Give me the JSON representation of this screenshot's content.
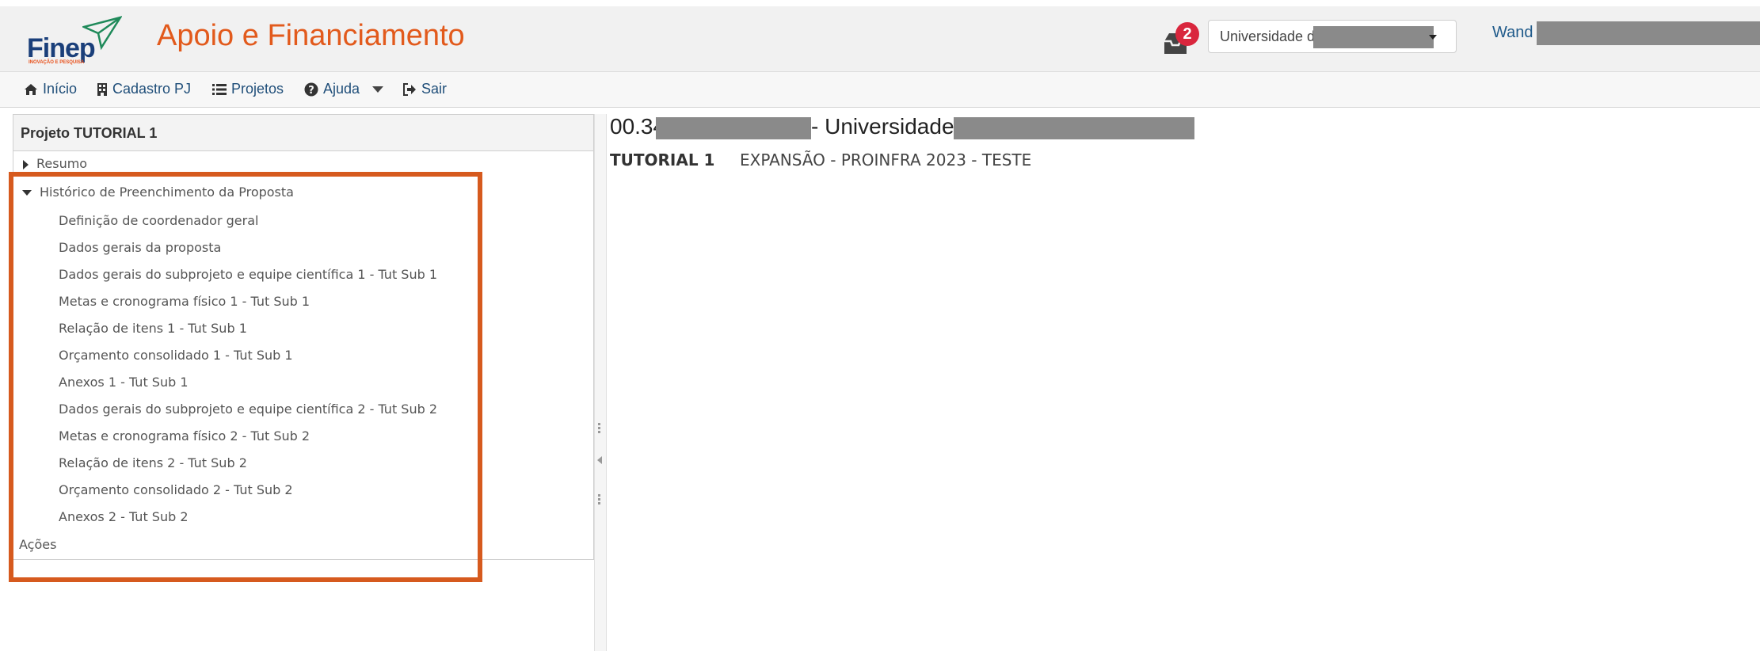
{
  "header": {
    "logo_text": "Finep",
    "logo_tagline": "INOVAÇÃO E PESQUISA",
    "app_title": "Apoio e Financiamento",
    "notification_count": "2",
    "org_select_value": "Universidade d",
    "user_name": "Wand"
  },
  "nav": {
    "items": [
      {
        "label": "Início",
        "icon": "home-icon"
      },
      {
        "label": "Cadastro PJ",
        "icon": "building-icon"
      },
      {
        "label": "Projetos",
        "icon": "list-icon"
      },
      {
        "label": "Ajuda",
        "icon": "question-icon"
      },
      {
        "label": "Sair",
        "icon": "sign-out-icon"
      }
    ]
  },
  "left_panel": {
    "title": "Projeto TUTORIAL 1",
    "resumo": "Resumo",
    "historico": "Histórico de Preenchimento da Proposta",
    "items": [
      "Definição de coordenador geral",
      "Dados gerais da proposta",
      "Dados gerais do subprojeto e equipe científica 1 - Tut Sub 1",
      "Metas e cronograma físico 1 - Tut Sub 1",
      "Relação de itens 1 - Tut Sub 1",
      "Orçamento consolidado 1 - Tut Sub 1",
      "Anexos 1 - Tut Sub 1",
      "Dados gerais do subprojeto e equipe científica 2 - Tut Sub 2",
      "Metas e cronograma físico 2 - Tut Sub 2",
      "Relação de itens 2 - Tut Sub 2",
      "Orçamento consolidado 2 - Tut Sub 2",
      "Anexos 2 - Tut Sub 2"
    ],
    "acoes": "Ações"
  },
  "main": {
    "title_prefix": "00.34",
    "title_mid": "- Universidade",
    "project_code": "TUTORIAL 1",
    "project_desc": "EXPANSÃO - PROINFRA 2023 - TESTE"
  },
  "colors": {
    "brand_orange": "#e25a1c",
    "link_blue": "#1f4e79",
    "highlight": "#d65a1e",
    "badge_red": "#d9263d"
  }
}
